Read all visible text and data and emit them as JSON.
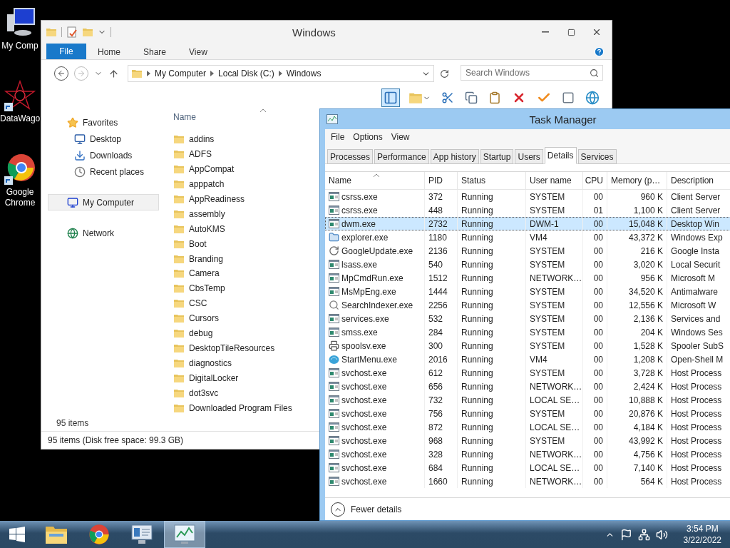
{
  "desktop_icons": [
    {
      "label": "My Comp",
      "kind": "computer"
    },
    {
      "label": "DataWago",
      "kind": "fractal"
    },
    {
      "label": "Google Chrome",
      "kind": "browser"
    }
  ],
  "explorer": {
    "title": "Windows",
    "file_tab": "File",
    "ribbon_tabs": [
      {
        "label": "Home",
        "selected": false
      },
      {
        "label": "Share",
        "selected": false
      },
      {
        "label": "View",
        "selected": false
      }
    ],
    "breadcrumbs": [
      "My Computer",
      "Local Disk (C:)",
      "Windows"
    ],
    "search": {
      "placeholder": "Search Windows"
    },
    "nav": [
      {
        "label": "Favorites",
        "kind": "favorites",
        "selected": false,
        "children": [
          {
            "label": "Desktop",
            "kind": "desktop",
            "selected": false
          },
          {
            "label": "Downloads",
            "kind": "downloads",
            "selected": false
          },
          {
            "label": "Recent places",
            "kind": "recent",
            "selected": false
          }
        ]
      },
      {
        "label": "My Computer",
        "kind": "computer",
        "selected": true
      },
      {
        "label": "Network",
        "kind": "network",
        "selected": false
      }
    ],
    "column": "Name",
    "folders": [
      "addins",
      "ADFS",
      "AppCompat",
      "apppatch",
      "AppReadiness",
      "assembly",
      "AutoKMS",
      "Boot",
      "Branding",
      "Camera",
      "CbsTemp",
      "CSC",
      "Cursors",
      "debug",
      "DesktopTileResources",
      "diagnostics",
      "DigitalLocker",
      "dot3svc",
      "Downloaded Program Files"
    ],
    "item_count": "95 items",
    "status": "95 items (Disk free space: 99.3 GB)"
  },
  "task_manager": {
    "title": "Task Manager",
    "menu": [
      "File",
      "Options",
      "View"
    ],
    "tabs": [
      {
        "label": "Processes",
        "selected": false
      },
      {
        "label": "Performance",
        "selected": false
      },
      {
        "label": "App history",
        "selected": false
      },
      {
        "label": "Startup",
        "selected": false
      },
      {
        "label": "Users",
        "selected": false
      },
      {
        "label": "Details",
        "selected": true
      },
      {
        "label": "Services",
        "selected": false
      }
    ],
    "columns": [
      "Name",
      "PID",
      "Status",
      "User name",
      "CPU",
      "Memory (p…",
      "Description"
    ],
    "rows": [
      {
        "name": "csrss.exe",
        "pid": "372",
        "status": "Running",
        "user": "SYSTEM",
        "cpu": "00",
        "memory": "960 K",
        "description": "Client Server",
        "kind": "app",
        "selected": false
      },
      {
        "name": "csrss.exe",
        "pid": "448",
        "status": "Running",
        "user": "SYSTEM",
        "cpu": "01",
        "memory": "1,100 K",
        "description": "Client Server",
        "kind": "app",
        "selected": false
      },
      {
        "name": "dwm.exe",
        "pid": "2732",
        "status": "Running",
        "user": "DWM-1",
        "cpu": "00",
        "memory": "15,048 K",
        "description": "Desktop Win",
        "kind": "app",
        "selected": true
      },
      {
        "name": "explorer.exe",
        "pid": "1180",
        "status": "Running",
        "user": "VM4",
        "cpu": "00",
        "memory": "43,372 K",
        "description": "Windows Exp",
        "kind": "explorer",
        "selected": false
      },
      {
        "name": "GoogleUpdate.exe",
        "pid": "2136",
        "status": "Running",
        "user": "SYSTEM",
        "cpu": "00",
        "memory": "216 K",
        "description": "Google Insta",
        "kind": "update",
        "selected": false
      },
      {
        "name": "lsass.exe",
        "pid": "540",
        "status": "Running",
        "user": "SYSTEM",
        "cpu": "00",
        "memory": "3,020 K",
        "description": "Local Securit",
        "kind": "app",
        "selected": false
      },
      {
        "name": "MpCmdRun.exe",
        "pid": "1512",
        "status": "Running",
        "user": "NETWORK…",
        "cpu": "00",
        "memory": "956 K",
        "description": "Microsoft M",
        "kind": "app",
        "selected": false
      },
      {
        "name": "MsMpEng.exe",
        "pid": "1444",
        "status": "Running",
        "user": "SYSTEM",
        "cpu": "00",
        "memory": "34,520 K",
        "description": "Antimalware",
        "kind": "app",
        "selected": false
      },
      {
        "name": "SearchIndexer.exe",
        "pid": "2256",
        "status": "Running",
        "user": "SYSTEM",
        "cpu": "00",
        "memory": "12,556 K",
        "description": "Microsoft W",
        "kind": "search",
        "selected": false
      },
      {
        "name": "services.exe",
        "pid": "532",
        "status": "Running",
        "user": "SYSTEM",
        "cpu": "00",
        "memory": "2,136 K",
        "description": "Services and",
        "kind": "app",
        "selected": false
      },
      {
        "name": "smss.exe",
        "pid": "284",
        "status": "Running",
        "user": "SYSTEM",
        "cpu": "00",
        "memory": "204 K",
        "description": "Windows Ses",
        "kind": "app",
        "selected": false
      },
      {
        "name": "spoolsv.exe",
        "pid": "300",
        "status": "Running",
        "user": "SYSTEM",
        "cpu": "00",
        "memory": "1,528 K",
        "description": "Spooler SubS",
        "kind": "printer",
        "selected": false
      },
      {
        "name": "StartMenu.exe",
        "pid": "2016",
        "status": "Running",
        "user": "VM4",
        "cpu": "00",
        "memory": "1,208 K",
        "description": "Open-Shell M",
        "kind": "shell",
        "selected": false
      },
      {
        "name": "svchost.exe",
        "pid": "612",
        "status": "Running",
        "user": "SYSTEM",
        "cpu": "00",
        "memory": "3,728 K",
        "description": "Host Process",
        "kind": "app",
        "selected": false
      },
      {
        "name": "svchost.exe",
        "pid": "656",
        "status": "Running",
        "user": "NETWORK…",
        "cpu": "00",
        "memory": "2,424 K",
        "description": "Host Process",
        "kind": "app",
        "selected": false
      },
      {
        "name": "svchost.exe",
        "pid": "732",
        "status": "Running",
        "user": "LOCAL SE…",
        "cpu": "00",
        "memory": "10,888 K",
        "description": "Host Process",
        "kind": "app",
        "selected": false
      },
      {
        "name": "svchost.exe",
        "pid": "756",
        "status": "Running",
        "user": "SYSTEM",
        "cpu": "00",
        "memory": "20,876 K",
        "description": "Host Process",
        "kind": "app",
        "selected": false
      },
      {
        "name": "svchost.exe",
        "pid": "872",
        "status": "Running",
        "user": "LOCAL SE…",
        "cpu": "00",
        "memory": "4,184 K",
        "description": "Host Process",
        "kind": "app",
        "selected": false
      },
      {
        "name": "svchost.exe",
        "pid": "968",
        "status": "Running",
        "user": "SYSTEM",
        "cpu": "00",
        "memory": "43,992 K",
        "description": "Host Process",
        "kind": "app",
        "selected": false
      },
      {
        "name": "svchost.exe",
        "pid": "328",
        "status": "Running",
        "user": "NETWORK…",
        "cpu": "00",
        "memory": "4,756 K",
        "description": "Host Process",
        "kind": "app",
        "selected": false
      },
      {
        "name": "svchost.exe",
        "pid": "684",
        "status": "Running",
        "user": "LOCAL SE…",
        "cpu": "00",
        "memory": "7,140 K",
        "description": "Host Process",
        "kind": "app",
        "selected": false
      },
      {
        "name": "svchost.exe",
        "pid": "1660",
        "status": "Running",
        "user": "NETWORK…",
        "cpu": "00",
        "memory": "564 K",
        "description": "Host Process",
        "kind": "app",
        "selected": false
      }
    ],
    "footer": "Fewer details"
  },
  "taskbar": {
    "apps": [
      {
        "kind": "explorer",
        "selected": false
      },
      {
        "kind": "browser",
        "selected": false
      },
      {
        "kind": "server",
        "selected": false
      },
      {
        "kind": "monitor",
        "selected": true
      }
    ],
    "time": "3:54 PM",
    "date": "3/22/2022"
  }
}
